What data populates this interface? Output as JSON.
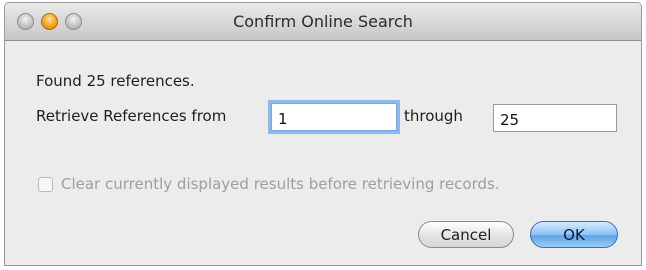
{
  "window": {
    "title": "Confirm Online Search"
  },
  "dialog": {
    "found_text": "Found 25 references.",
    "retrieve_label": "Retrieve References from",
    "from_value": "1",
    "through_label": "through",
    "to_value": "25",
    "clear_results_label": "Clear currently displayed results before retrieving records.",
    "clear_results_checked": false,
    "clear_results_enabled": false
  },
  "buttons": {
    "cancel_label": "Cancel",
    "ok_label": "OK"
  },
  "colors": {
    "focus_ring": "#8fb8ec",
    "default_button": "#5ea2e8",
    "minimize_button": "#f4a31c"
  }
}
